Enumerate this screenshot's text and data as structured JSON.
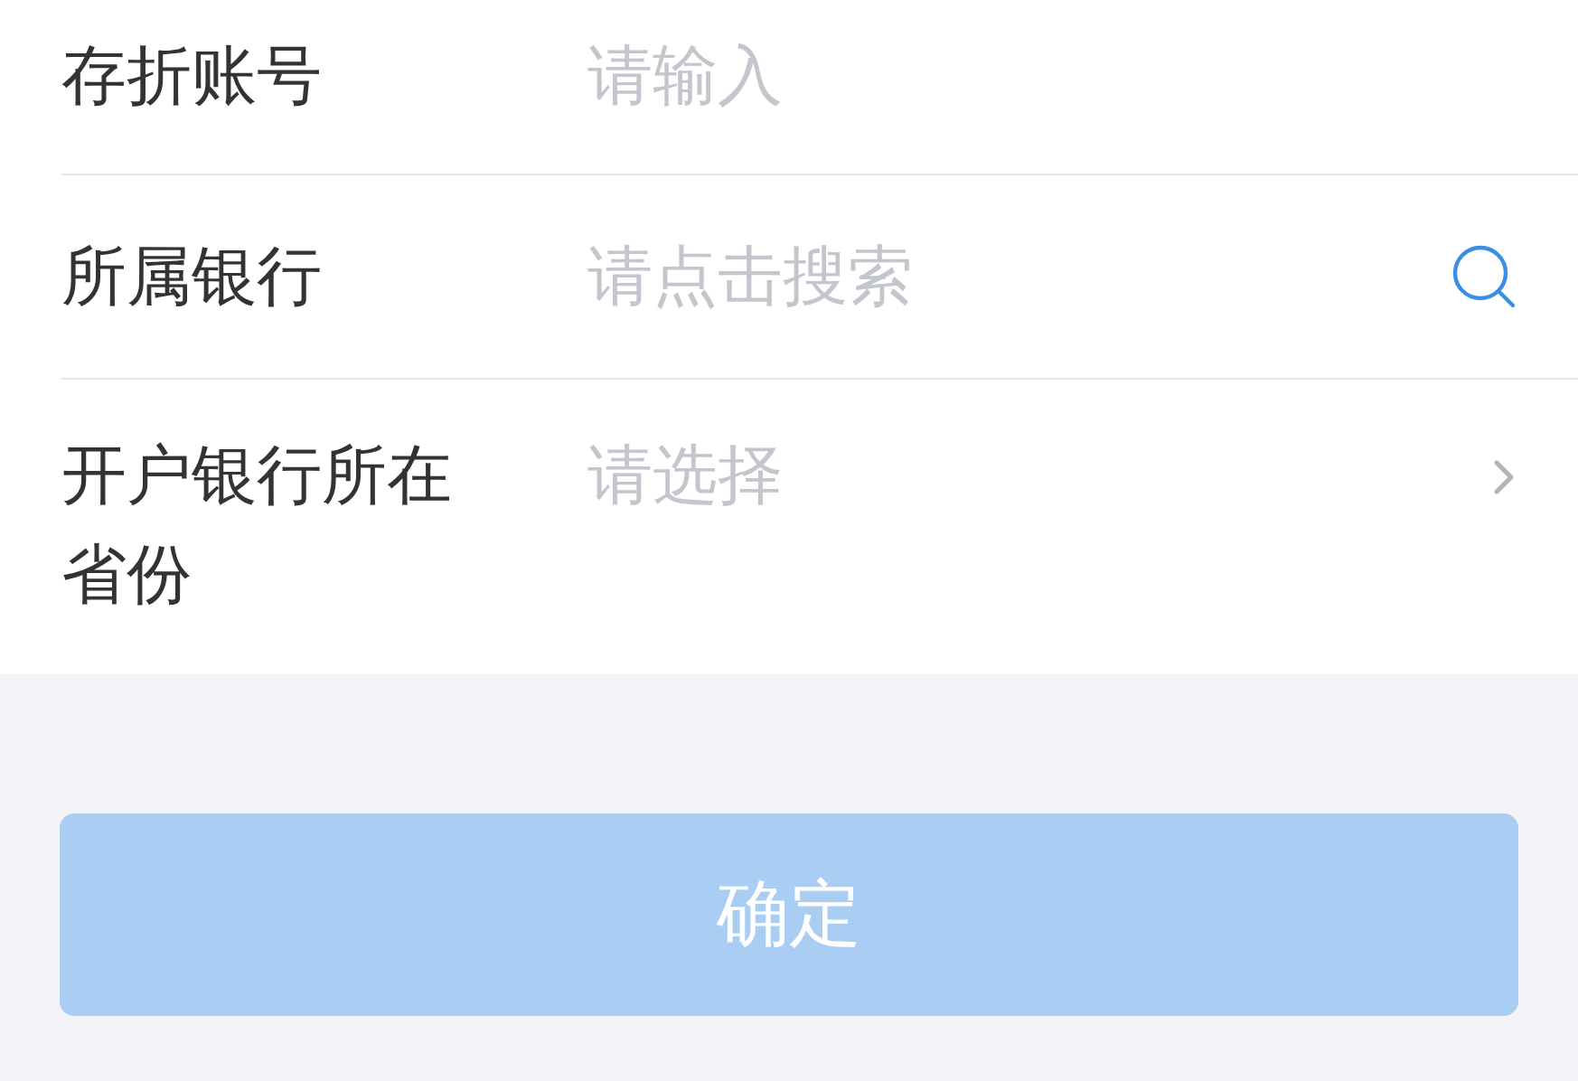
{
  "fields": [
    {
      "kind": "input",
      "label": "存折账号",
      "placeholder": "请输入"
    },
    {
      "kind": "search",
      "label": "所属银行",
      "placeholder": "请点击搜索"
    },
    {
      "kind": "select",
      "label": "开户银行所在省份",
      "placeholder": "请选择"
    }
  ],
  "submit": {
    "label": "确定",
    "disabled": true
  }
}
